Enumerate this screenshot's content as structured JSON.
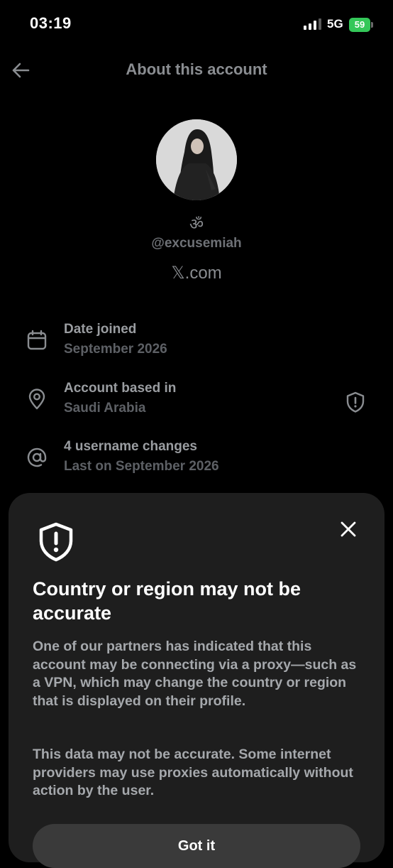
{
  "status_bar": {
    "time": "03:19",
    "network": "5G",
    "battery": "59"
  },
  "header": {
    "title": "About this account"
  },
  "profile": {
    "display_name": "ॐ",
    "handle": "@excusemiah",
    "site": "𝕏.com"
  },
  "info": [
    {
      "label": "Date joined",
      "value": "September 2026",
      "icon": "calendar-icon"
    },
    {
      "label": "Account based in",
      "value": "Saudi Arabia",
      "icon": "location-pin-icon",
      "trailing_icon": "shield-alert-icon"
    },
    {
      "label": "4 username changes",
      "value": "Last on September 2026",
      "icon": "at-sign-icon"
    }
  ],
  "sheet": {
    "title": "Country or region may not be accurate",
    "body1": "One of our partners has indicated that this account may be connecting via a proxy—such as a VPN, which may change the country or region that is displayed on their profile.",
    "body2": "This data may not be accurate. Some internet providers may use proxies automatically without action by the user.",
    "button_label": "Got it"
  },
  "colors": {
    "background": "#000000",
    "sheet": "#1e1e1e",
    "battery_green": "#34c759",
    "muted_text": "#8a8d91"
  }
}
